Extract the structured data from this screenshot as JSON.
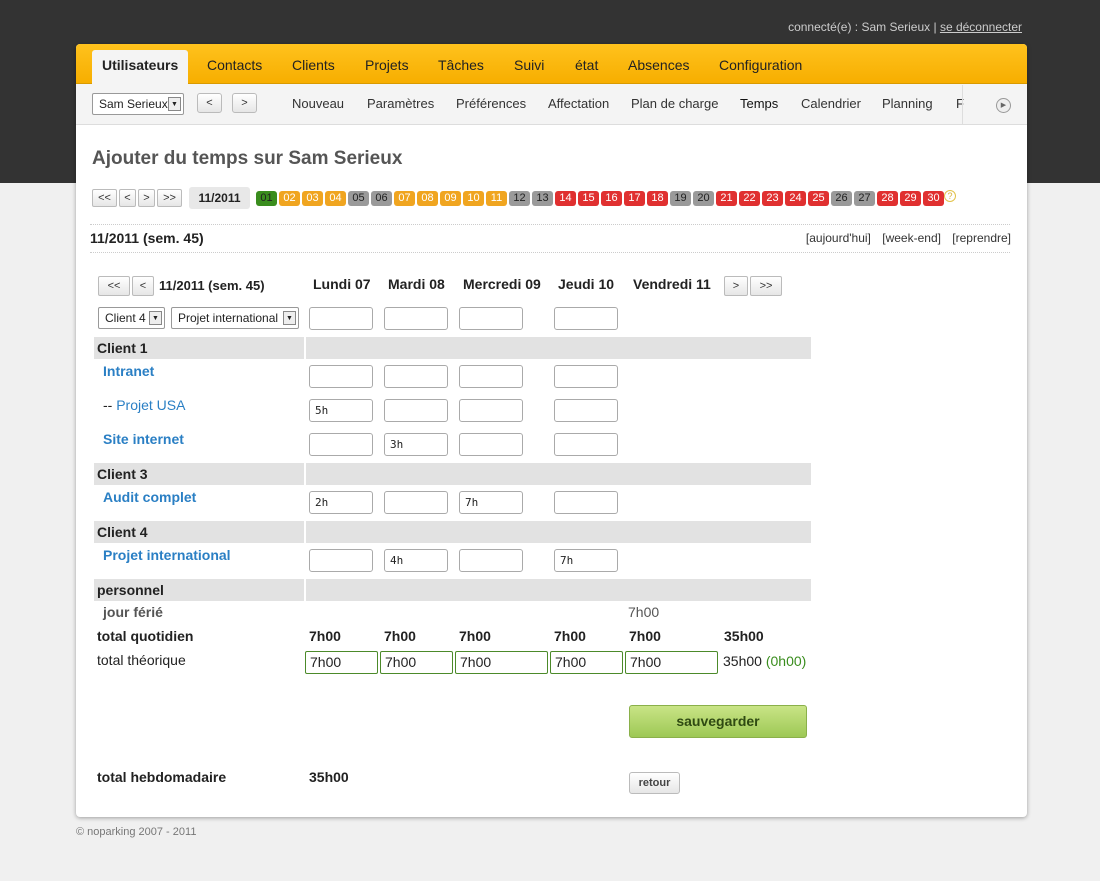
{
  "userbar": {
    "text": "connecté(e) : Sam Serieux | ",
    "logout": "se déconnecter"
  },
  "mainnav": [
    "Utilisateurs",
    "Contacts",
    "Clients",
    "Projets",
    "Tâches",
    "Suivi",
    "état",
    "Absences",
    "Configuration"
  ],
  "user_select": "Sam Serieux",
  "nav_prev": "<",
  "nav_next": ">",
  "subnav": [
    "Nouveau",
    "Paramètres",
    "Préférences",
    "Affectation",
    "Plan de charge",
    "Temps",
    "Calendrier",
    "Planning",
    "F"
  ],
  "page_title": "Ajouter du temps sur Sam Serieux",
  "month_nav": {
    "first": "<<",
    "prev": "<",
    "next": ">",
    "last": ">>",
    "label": "11/2011"
  },
  "days": [
    {
      "n": "01",
      "s": "green"
    },
    {
      "n": "02",
      "s": "orange"
    },
    {
      "n": "03",
      "s": "orange"
    },
    {
      "n": "04",
      "s": "orange"
    },
    {
      "n": "05",
      "s": "grey"
    },
    {
      "n": "06",
      "s": "grey"
    },
    {
      "n": "07",
      "s": "orange"
    },
    {
      "n": "08",
      "s": "orange"
    },
    {
      "n": "09",
      "s": "orange"
    },
    {
      "n": "10",
      "s": "orange"
    },
    {
      "n": "11",
      "s": "orange"
    },
    {
      "n": "12",
      "s": "grey"
    },
    {
      "n": "13",
      "s": "grey"
    },
    {
      "n": "14",
      "s": "red"
    },
    {
      "n": "15",
      "s": "red"
    },
    {
      "n": "16",
      "s": "red"
    },
    {
      "n": "17",
      "s": "red"
    },
    {
      "n": "18",
      "s": "red"
    },
    {
      "n": "19",
      "s": "grey"
    },
    {
      "n": "20",
      "s": "grey"
    },
    {
      "n": "21",
      "s": "red"
    },
    {
      "n": "22",
      "s": "red"
    },
    {
      "n": "23",
      "s": "red"
    },
    {
      "n": "24",
      "s": "red"
    },
    {
      "n": "25",
      "s": "red"
    },
    {
      "n": "26",
      "s": "grey"
    },
    {
      "n": "27",
      "s": "grey"
    },
    {
      "n": "28",
      "s": "red"
    },
    {
      "n": "29",
      "s": "red"
    },
    {
      "n": "30",
      "s": "red"
    }
  ],
  "help": "?",
  "week_title": "11/2011 (sem. 45)",
  "links": [
    "[aujourd'hui]",
    "[week-end]",
    "[reprendre]"
  ],
  "table": {
    "week_prev2": "<<",
    "week_prev": "<",
    "week_label": "11/2011 (sem. 45)",
    "week_next": ">",
    "week_next2": ">>",
    "columns": [
      "Lundi 07",
      "Mardi 08",
      "Mercredi 09",
      "Jeudi 10",
      "Vendredi 11"
    ],
    "client_select": "Client 4",
    "project_select": "Projet international",
    "new_row": [
      "",
      "",
      "",
      ""
    ],
    "groups": [
      "Client 1",
      "Client 3",
      "Client 4",
      "personnel"
    ],
    "projects": [
      {
        "prefix": "",
        "name": "Intranet",
        "values": [
          "",
          "",
          "",
          ""
        ]
      },
      {
        "prefix": "-- ",
        "name": "Projet USA",
        "values": [
          "5h",
          "",
          "",
          ""
        ]
      },
      {
        "prefix": "",
        "name": "Site internet",
        "values": [
          "",
          "3h",
          "",
          ""
        ]
      },
      {
        "prefix": "",
        "name": "Audit complet",
        "values": [
          "2h",
          "",
          "7h",
          ""
        ]
      },
      {
        "prefix": "",
        "name": "Projet international",
        "values": [
          "",
          "4h",
          "",
          "7h"
        ]
      }
    ],
    "holiday": {
      "label": "jour férié",
      "value": "7h00"
    },
    "total_daily": {
      "label": "total quotidien",
      "values": [
        "7h00",
        "7h00",
        "7h00",
        "7h00",
        "7h00"
      ],
      "total": "35h00"
    },
    "total_theo": {
      "label": "total théorique",
      "values": [
        "7h00",
        "7h00",
        "7h00",
        "7h00",
        "7h00"
      ],
      "total": "35h00",
      "diff": "(0h00)"
    },
    "save": "sauvegarder",
    "total_weekly": {
      "label": "total hebdomadaire",
      "value": "35h00"
    },
    "back": "retour"
  },
  "footer": "© noparking 2007 - 2011",
  "colors": {
    "accent": "#f7ae00",
    "link": "#2a7fc4",
    "ok": "#3a8d1e"
  }
}
